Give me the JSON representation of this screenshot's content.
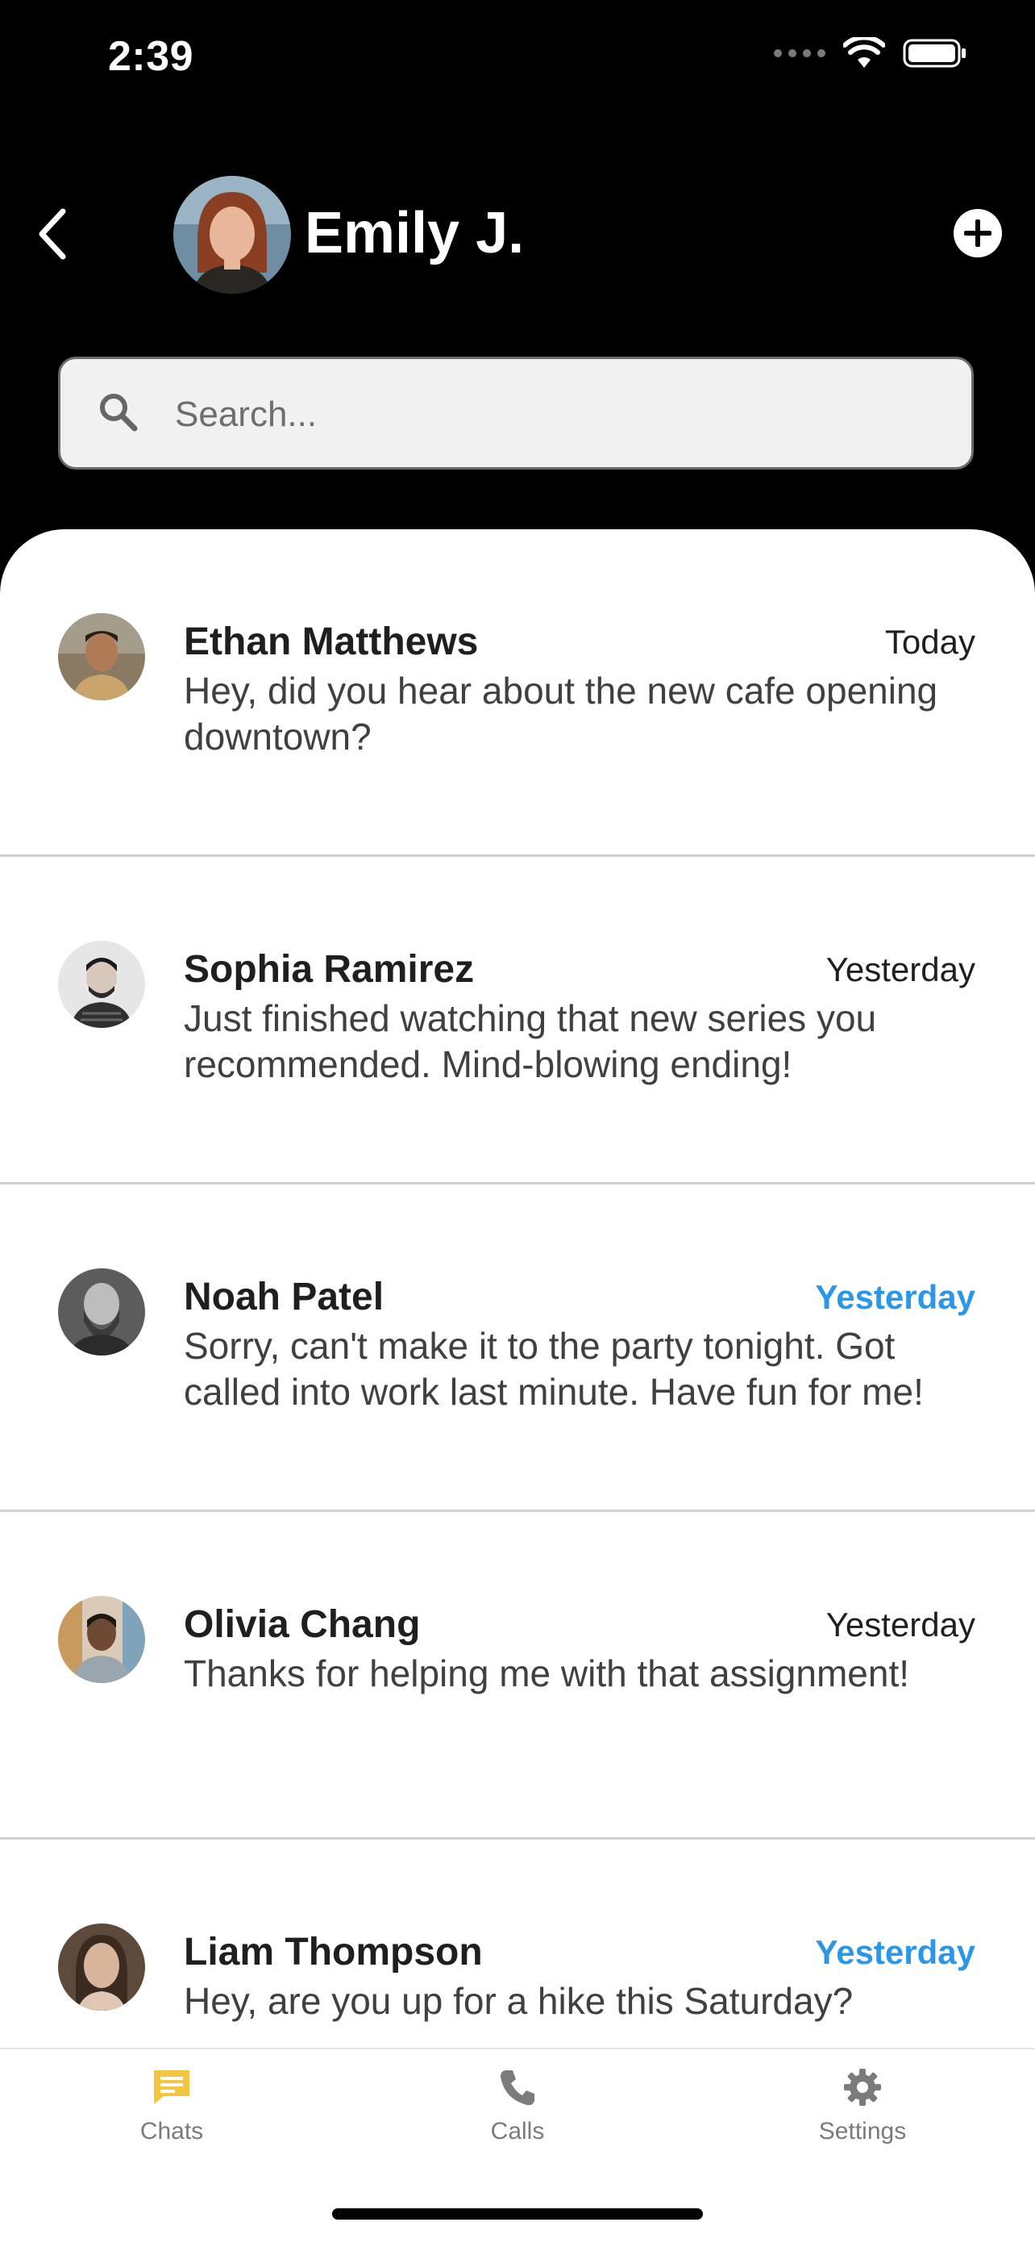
{
  "status_bar": {
    "time": "2:39"
  },
  "header": {
    "name": "Emily J."
  },
  "search": {
    "placeholder": "Search..."
  },
  "chats": [
    {
      "name": "Ethan Matthews",
      "time": "Today",
      "unread": false,
      "message": "Hey, did you hear about the new cafe opening downtown?"
    },
    {
      "name": "Sophia Ramirez",
      "time": "Yesterday",
      "unread": false,
      "message": "Just finished watching that new series you recommended. Mind-blowing ending!"
    },
    {
      "name": "Noah Patel",
      "time": "Yesterday",
      "unread": true,
      "message": "Sorry, can't make it to the party tonight. Got called into work last minute. Have fun for me!"
    },
    {
      "name": "Olivia Chang",
      "time": "Yesterday",
      "unread": false,
      "message": "Thanks for helping me with that assignment!"
    },
    {
      "name": "Liam Thompson",
      "time": "Yesterday",
      "unread": true,
      "message": "Hey, are you up for a hike this Saturday?"
    }
  ],
  "tabs": [
    {
      "label": "Chats",
      "icon": "chat-bubble-icon",
      "active": true
    },
    {
      "label": "Calls",
      "icon": "phone-icon",
      "active": false
    },
    {
      "label": "Settings",
      "icon": "gear-icon",
      "active": false
    }
  ],
  "colors": {
    "accent": "#2a97e8",
    "active_tab": "#f5c542",
    "header_bg": "#000000"
  }
}
